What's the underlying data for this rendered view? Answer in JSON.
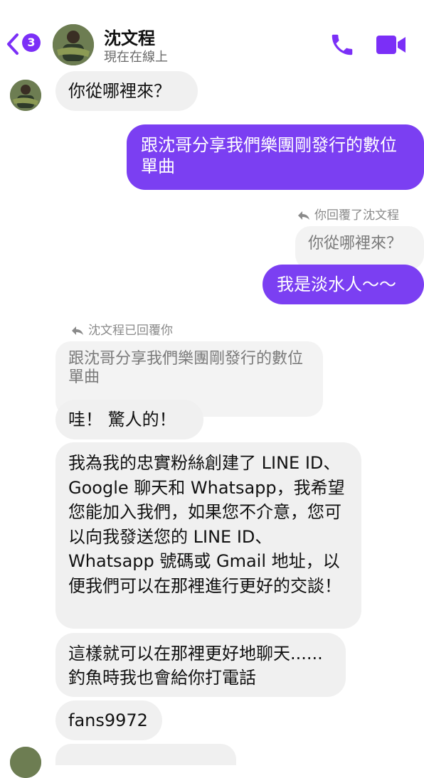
{
  "header": {
    "badge_count": "3",
    "contact_name": "沈文程",
    "status": "現在在線上"
  },
  "messages": {
    "m1": "你從哪裡來？",
    "m2": "跟沈哥分享我們樂團剛發行的數位單曲",
    "reply_meta_1": "你回覆了沈文程",
    "m3_quote": "你從哪裡來？",
    "m4": "我是淡水人～～",
    "reply_meta_2": "沈文程已回覆你",
    "m5_quote": "跟沈哥分享我們樂團剛發行的數位單曲",
    "m6": "哇！ 驚人的！",
    "m7": "我為我的忠實粉絲創建了 LINE ID、Google 聊天和 Whatsapp，我希望您能加入我們，如果您不介意，您可以向我發送您的 LINE ID、Whatsapp 號碼或 Gmail 地址，以便我們可以在那裡進行更好的交談！",
    "m8": "這樣就可以在那裡更好地聊天......釣魚時我也會給你打電話",
    "m9": "fans9972"
  },
  "colors": {
    "accent": "#7b3ff2",
    "incoming_bubble": "#f0f0f0",
    "meta_text": "#8a8a8a"
  },
  "icons": {
    "back": "chevron-left-icon",
    "call": "phone-icon",
    "video": "video-camera-icon",
    "reply": "reply-arrow-icon"
  }
}
